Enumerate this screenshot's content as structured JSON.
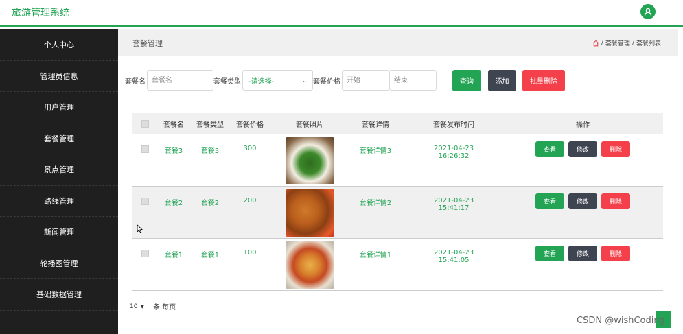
{
  "header": {
    "title": "旅游管理系统",
    "user_icon": "user-icon"
  },
  "sidebar": {
    "items": [
      {
        "label": "个人中心"
      },
      {
        "label": "管理员信息"
      },
      {
        "label": "用户管理"
      },
      {
        "label": "套餐管理"
      },
      {
        "label": "景点管理"
      },
      {
        "label": "路线管理"
      },
      {
        "label": "新闻管理"
      },
      {
        "label": "轮播图管理"
      },
      {
        "label": "基础数据管理"
      }
    ]
  },
  "page": {
    "title": "套餐管理",
    "breadcrumb": [
      "套餐管理",
      "套餐列表"
    ],
    "breadcrumb_sep": "/"
  },
  "search": {
    "name_label": "套餐名",
    "name_placeholder": "套餐名",
    "type_label": "套餐类型",
    "type_value": "-请选择-",
    "price_label": "套餐价格",
    "price_start_placeholder": "开始",
    "price_end_placeholder": "结束",
    "query_button": "查询",
    "add_button": "添加",
    "batch_delete_button": "批量删除"
  },
  "table": {
    "columns": [
      "套餐名",
      "套餐类型",
      "套餐价格",
      "套餐照片",
      "套餐详情",
      "套餐发布时间",
      "操作"
    ],
    "rows": [
      {
        "name": "套餐3",
        "type": "套餐3",
        "price": "300",
        "detail": "套餐详情3",
        "time": "2021-04-23 16:26:32"
      },
      {
        "name": "套餐2",
        "type": "套餐2",
        "price": "200",
        "detail": "套餐详情2",
        "time": "2021-04-23 15:41:17"
      },
      {
        "name": "套餐1",
        "type": "套餐1",
        "price": "100",
        "detail": "套餐详情1",
        "time": "2021-04-23 15:41:05"
      }
    ],
    "actions": {
      "view": "查看",
      "edit": "修改",
      "delete": "删除"
    }
  },
  "pagination": {
    "page_size": "10",
    "per_page_label": "条 每页"
  },
  "watermark": "CSDN @wishCoding",
  "colors": {
    "accent": "#23a455",
    "dark": "#3f4451",
    "danger": "#f4404a"
  }
}
